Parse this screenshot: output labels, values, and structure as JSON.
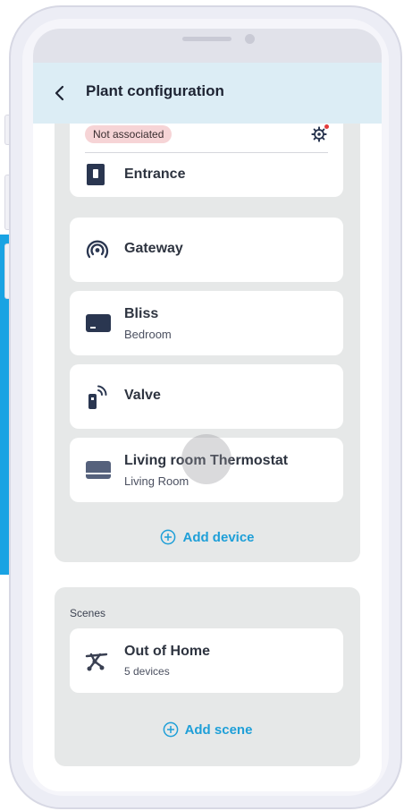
{
  "header": {
    "title": "Plant configuration",
    "back_icon": "chevron-left-icon"
  },
  "devices": {
    "entrance": {
      "badge": "Not associated",
      "settings_icon": "gear-icon",
      "title": "Entrance",
      "icon": "door-panel-icon"
    },
    "items": [
      {
        "title": "Gateway",
        "subtitle": "",
        "icon": "gateway-icon"
      },
      {
        "title": "Bliss",
        "subtitle": "Bedroom",
        "icon": "display-device-icon"
      },
      {
        "title": "Valve",
        "subtitle": "",
        "icon": "valve-icon"
      },
      {
        "title": "Living room Thermostat",
        "subtitle": "Living Room",
        "icon": "thermostat-icon"
      }
    ],
    "add_label": "Add device"
  },
  "scenes": {
    "label": "Scenes",
    "items": [
      {
        "title": "Out of Home",
        "subtitle": "5 devices",
        "icon": "scene-icon"
      }
    ],
    "add_label": "Add scene"
  },
  "colors": {
    "accent": "#1e9fd8",
    "header_bg": "#dcedf5",
    "group_bg": "#e6e8e8",
    "badge_bg": "#f6d4d6",
    "icon_navy": "#2a3650"
  }
}
